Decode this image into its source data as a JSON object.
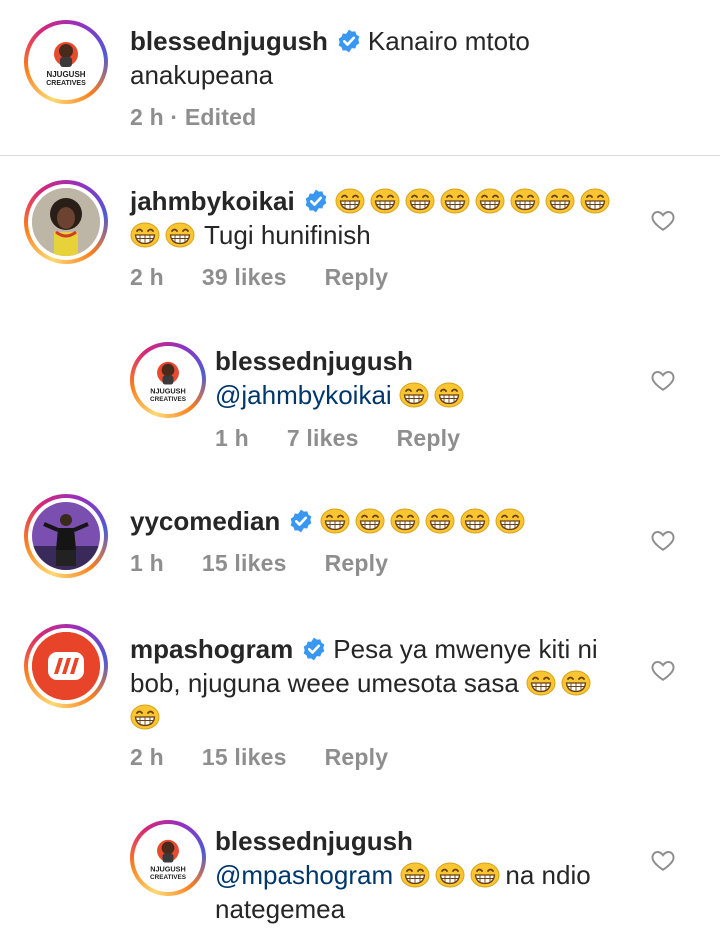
{
  "comments": [
    {
      "username": "blessednjugush",
      "verified": true,
      "text": "Kanairo mtoto anakupeana",
      "time": "2 h",
      "edited": "Edited",
      "avatar_label_1": "NJUGUSH",
      "avatar_label_2": "CREATIVES"
    },
    {
      "username": "jahmbykoikai",
      "verified": true,
      "emoji_count_line1": 8,
      "emoji_count_line2": 2,
      "text": "Tugi hunifinish",
      "time": "2 h",
      "likes": "39 likes",
      "reply_label": "Reply"
    },
    {
      "username": "blessednjugush",
      "mention": "@jahmbykoikai",
      "emoji_count": 2,
      "time": "1 h",
      "likes": "7 likes",
      "reply_label": "Reply"
    },
    {
      "username": "yycomedian",
      "verified": true,
      "emoji_count": 6,
      "time": "1 h",
      "likes": "15 likes",
      "reply_label": "Reply"
    },
    {
      "username": "mpashogram",
      "verified": true,
      "text_line1": "Pesa ya mwenye kiti ni",
      "text_line2": "bob, njuguna weee umesota sasa",
      "emoji_count": 3,
      "time": "2 h",
      "likes": "15 likes",
      "reply_label": "Reply"
    },
    {
      "username": "blessednjugush",
      "mention": "@mpashogram",
      "text_after_emoji": "na ndio",
      "text_line2": "nategemea",
      "emoji_count": 3
    }
  ],
  "colors": {
    "username": "#262626",
    "mention": "#00376b",
    "meta": "#8e8e8e",
    "verified": "#3897f0",
    "mpasho_brand": "#e8442a"
  },
  "icons": [
    "verified-badge-icon",
    "heart-outline-icon",
    "grinning-emoji-icon"
  ]
}
